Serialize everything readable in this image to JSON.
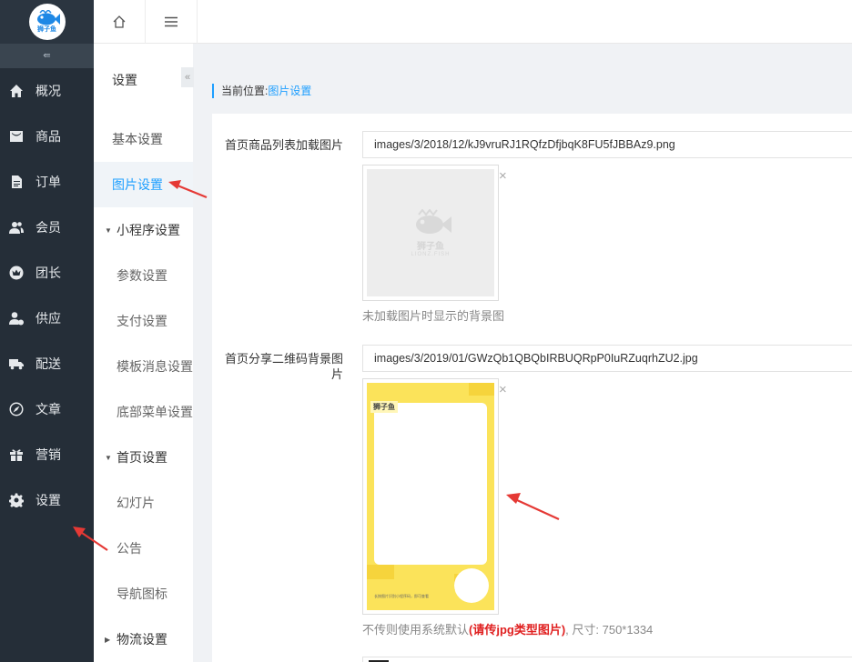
{
  "brand": {
    "logo_text": "狮子鱼"
  },
  "rail": {
    "items": [
      {
        "label": "概况",
        "icon": "home-icon"
      },
      {
        "label": "商品",
        "icon": "goods-icon"
      },
      {
        "label": "订单",
        "icon": "order-icon"
      },
      {
        "label": "会员",
        "icon": "member-icon"
      },
      {
        "label": "团长",
        "icon": "crown-icon"
      },
      {
        "label": "供应",
        "icon": "supplier-icon"
      },
      {
        "label": "配送",
        "icon": "truck-icon"
      },
      {
        "label": "文章",
        "icon": "compass-icon"
      },
      {
        "label": "营销",
        "icon": "gift-icon"
      },
      {
        "label": "设置",
        "icon": "gear-icon"
      }
    ]
  },
  "submenu": {
    "title": "设置",
    "fold_icon": "«",
    "basic": "基本设置",
    "image": "图片设置",
    "miniapp": {
      "label": "小程序设置",
      "children": [
        "参数设置",
        "支付设置",
        "模板消息设置",
        "底部菜单设置"
      ]
    },
    "home": {
      "label": "首页设置",
      "children": [
        "幻灯片",
        "公告",
        "导航图标"
      ]
    },
    "logistics": {
      "label": "物流设置"
    }
  },
  "breadcrumb": {
    "prefix": "当前位置:",
    "current": "图片设置"
  },
  "form": {
    "loading_image": {
      "label": "首页商品列表加载图片",
      "path": "images/3/2018/12/kJ9vruRJ1RQfzDfjbqK8FU5fJBBAz9.png",
      "hint": "未加载图片时显示的背景图",
      "placeholder_logo": "狮子鱼",
      "placeholder_sub": "LIONZ.FISH"
    },
    "share_qr_bg": {
      "label": "首页分享二维码背景图片",
      "path": "images/3/2019/01/GWzQb1QBQbIRBUQRpP0IuRZuqrhZU2.jpg",
      "hint_prefix": "不传则使用系统默认",
      "hint_red": "(请传jpg类型图片)",
      "hint_suffix": ", 尺寸: 750*1334",
      "poster_tag": "狮子鱼",
      "poster_foot": "长按图片识别小程序码，即可查看"
    },
    "remove_symbol": "×"
  },
  "colors": {
    "accent": "#1e9fff",
    "rail_bg": "#252e38",
    "annotation_red": "#e53935"
  }
}
